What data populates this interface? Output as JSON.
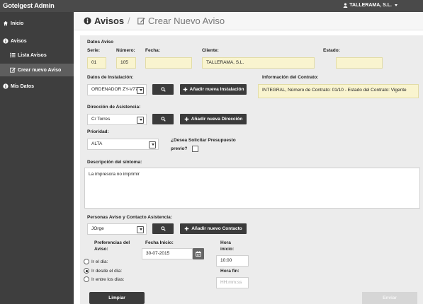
{
  "app": {
    "brand": "Gotelgest Admin",
    "user": "TALLERAMA, S.L."
  },
  "sidebar": {
    "items": [
      {
        "label": "Inicio",
        "icon": "home-icon"
      },
      {
        "label": "Avisos",
        "icon": "info-icon"
      },
      {
        "label": "Lista Avisos",
        "icon": "list-icon"
      },
      {
        "label": "Crear nuevo Aviso",
        "icon": "edit-icon",
        "active": true
      },
      {
        "label": "Mis Datos",
        "icon": "info-icon"
      }
    ]
  },
  "header": {
    "section": "Avisos",
    "separator": "/",
    "page": "Crear Nuevo Aviso"
  },
  "form": {
    "datos_aviso": "Datos Aviso",
    "serie": {
      "label": "Serie:",
      "value": "01"
    },
    "numero": {
      "label": "Número:",
      "value": "105"
    },
    "fecha": {
      "label": "Fecha:",
      "value": ""
    },
    "cliente": {
      "label": "Cliente:",
      "value": "TALLERAMA, S.L."
    },
    "estado": {
      "label": "Estado:",
      "value": ""
    },
    "instalacion": {
      "label": "Datos de Instalación:",
      "value": "ORDENADOR ZY-V77",
      "add_label": "Añadir nueva Instalación"
    },
    "contrato": {
      "label": "Información del Contrato:",
      "value": "INTEGRAL, Número de Contrato: 01/10 - Estado del Contrato: Vigente"
    },
    "direccion": {
      "label": "Dirección de Asistencia:",
      "value": "C/ Torres",
      "add_label": "Añadir nueva Dirección"
    },
    "prioridad": {
      "label": "Prioridad:",
      "value": "ALTA"
    },
    "presupuesto": {
      "label_1": "¿Desea Solicitar Presupuesto",
      "label_2": "previo?"
    },
    "sintoma": {
      "label": "Descripción del síntoma:",
      "value": "La impresora no imprimir"
    },
    "personas": {
      "label": "Personas Aviso y Contacto Asistencia:",
      "value": "JOrge",
      "add_label": "Añadir nuevo Contacto"
    },
    "preferencias": {
      "label_1": "Preferencias del",
      "label_2": "Aviso:",
      "options": [
        "Ir el día:",
        "Ir desde el día:",
        "Ir entre los días:"
      ],
      "selected_index": 1
    },
    "fecha_inicio": {
      "label": "Fecha Inicio:",
      "value": "30-07-2015"
    },
    "hora_inicio": {
      "label_1": "Hora",
      "label_2": "inicio:",
      "value": "10:00"
    },
    "hora_fin": {
      "label": "Hora fin:",
      "placeholder": "HH:mm:ss"
    },
    "limpiar_label": "Limpiar",
    "enviar_label": "Enviar"
  }
}
